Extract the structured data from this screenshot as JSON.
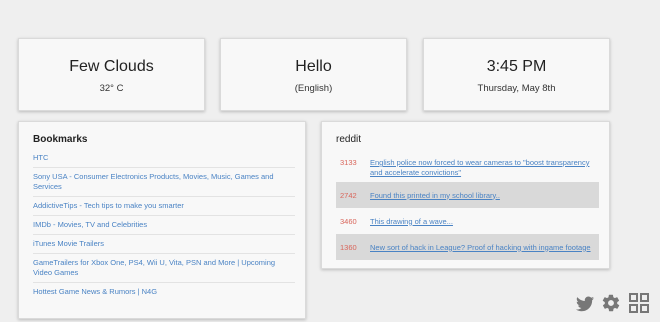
{
  "weather": {
    "condition": "Few Clouds",
    "temperature": "32° C"
  },
  "greeting": {
    "text": "Hello",
    "language": "(English)"
  },
  "clock": {
    "time": "3:45 PM",
    "date": "Thursday, May 8th"
  },
  "bookmarks": {
    "title": "Bookmarks",
    "items": [
      {
        "label": "HTC"
      },
      {
        "label": "Sony USA - Consumer Electronics Products, Movies, Music, Games and Services"
      },
      {
        "label": "AddictiveTips - Tech tips to make you smarter"
      },
      {
        "label": "IMDb - Movies, TV and Celebrities"
      },
      {
        "label": "iTunes Movie Trailers"
      },
      {
        "label": "GameTrailers for Xbox One, PS4, Wii U, Vita, PSN and More | Upcoming Video Games"
      },
      {
        "label": "Hottest Game News & Rumors | N4G"
      }
    ]
  },
  "reddit": {
    "title": "reddit",
    "posts": [
      {
        "score": "3133",
        "title": "English police now forced to wear cameras to \"boost transparency and accelerate convictions\""
      },
      {
        "score": "2742",
        "title": "Found this printed in my school library.."
      },
      {
        "score": "3460",
        "title": "This drawing of a wave..."
      },
      {
        "score": "1360",
        "title": "New sort of hack in League? Proof of hacking with ingame footage"
      }
    ]
  },
  "dock": {
    "icons": [
      "twitter-icon",
      "gear-icon",
      "apps-grid-icon"
    ]
  },
  "colors": {
    "link": "#4a83c4",
    "score": "#d9665b",
    "shaded_row": "#d9d9d9",
    "background": "#efefef"
  }
}
